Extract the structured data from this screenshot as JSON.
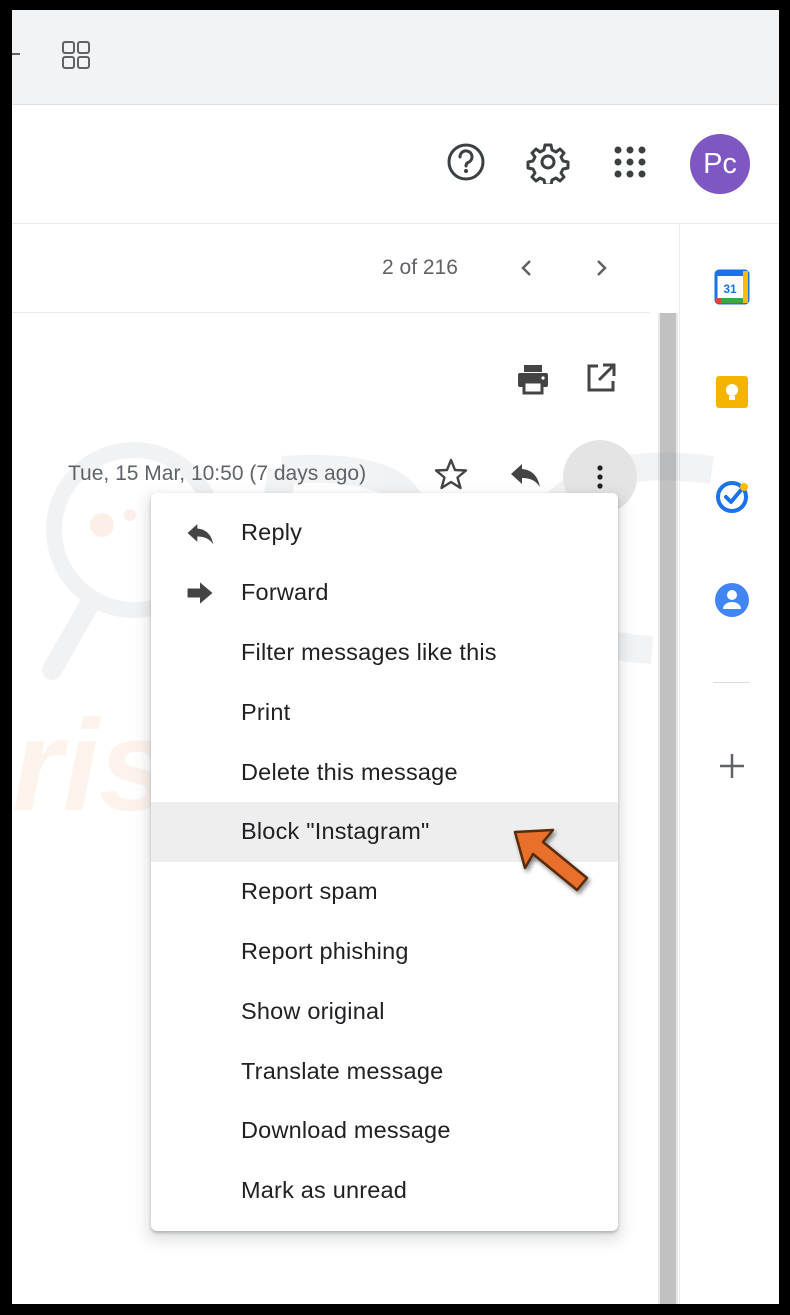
{
  "header": {
    "avatar_initials": "Pc",
    "avatar_color": "#7e57c2"
  },
  "toolbar": {
    "pagination": "2 of 216"
  },
  "message": {
    "date": "Tue, 15 Mar, 10:50 (7 days ago)"
  },
  "menu": {
    "items": [
      {
        "label": "Reply",
        "icon": "reply-icon"
      },
      {
        "label": "Forward",
        "icon": "forward-icon"
      },
      {
        "label": "Filter messages like this"
      },
      {
        "label": "Print"
      },
      {
        "label": "Delete this message"
      },
      {
        "label": "Block \"Instagram\"",
        "highlighted": true
      },
      {
        "label": "Report spam"
      },
      {
        "label": "Report phishing"
      },
      {
        "label": "Show original"
      },
      {
        "label": "Translate message"
      },
      {
        "label": "Download message"
      },
      {
        "label": "Mark as unread"
      }
    ]
  },
  "side_panel": {
    "calendar_day": "31"
  },
  "colors": {
    "annotation_arrow": "#e8702a",
    "calendar_blue": "#1a73e8",
    "keep_yellow": "#f4b400",
    "tasks_blue": "#1a73e8",
    "contacts_blue": "#4285f4"
  }
}
